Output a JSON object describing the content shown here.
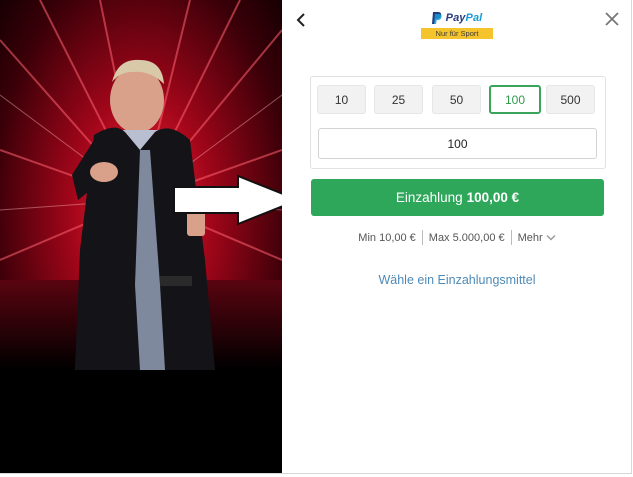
{
  "paypal": {
    "word_pay": "Pay",
    "word_pal": "Pal",
    "badge": "Nur für Sport"
  },
  "amount_options": [
    "10",
    "25",
    "50",
    "100",
    "500"
  ],
  "selected_amount": "100",
  "amount_input": {
    "value": "100"
  },
  "deposit_button": {
    "label": "Einzahlung",
    "amount": "100,00 €"
  },
  "limits": {
    "min": "Min 10,00 €",
    "max": "Max 5.000,00 €",
    "more": "Mehr"
  },
  "method_link": "Wähle ein Einzahlungsmittel",
  "colors": {
    "accent_green": "#2ea75a",
    "link_blue": "#4f8ab7",
    "badge_yellow": "#f5c42c"
  },
  "icons": {
    "back": "chevron-left-icon",
    "close": "close-icon",
    "more": "chevron-down-icon",
    "promo_arrow": "arrow-right-icon"
  }
}
